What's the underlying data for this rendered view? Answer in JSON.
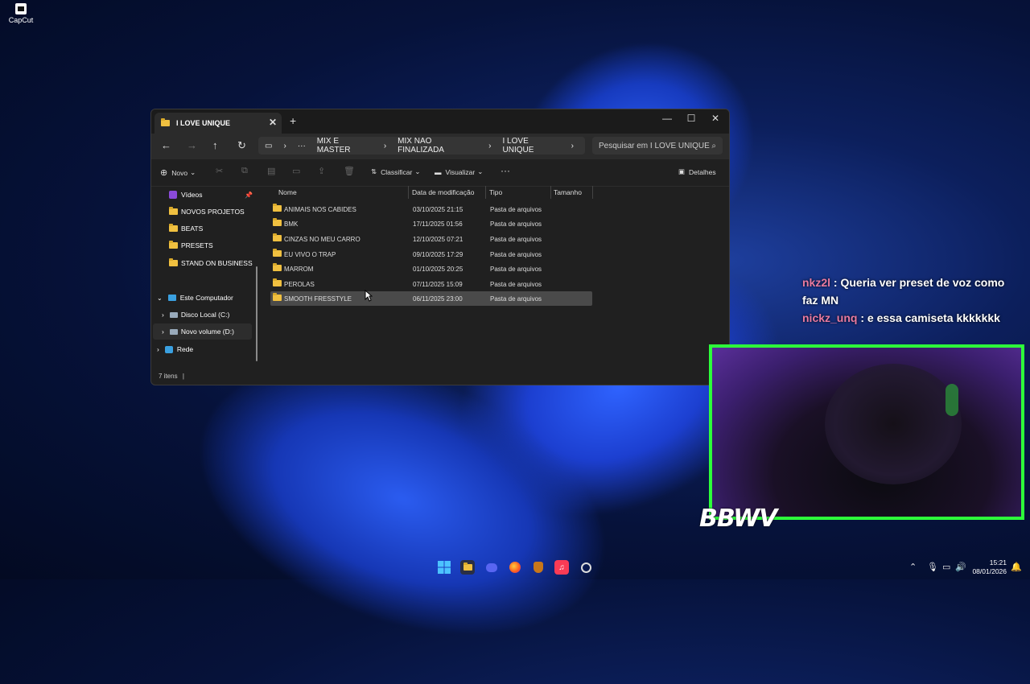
{
  "desktop": {
    "icons": [
      {
        "label": "CapCut",
        "icon": "capcut-icon"
      }
    ]
  },
  "explorer": {
    "tab_title": "I LOVE UNIQUE",
    "breadcrumb": [
      "MIX E MASTER",
      "MIX NAO FINALIZADA",
      "I LOVE UNIQUE"
    ],
    "search_placeholder": "Pesquisar em I LOVE UNIQUE",
    "toolbar": {
      "new": "Novo",
      "sort": "Classificar",
      "view": "Visualizar",
      "details": "Detalhes"
    },
    "sidebar": [
      {
        "label": "Vídeos",
        "icon": "videos-icon",
        "pinned": true
      },
      {
        "label": "NOVOS PROJETOS",
        "icon": "folder-icon"
      },
      {
        "label": "BEATS",
        "icon": "folder-icon"
      },
      {
        "label": "PRESETS",
        "icon": "folder-icon"
      },
      {
        "label": "STAND ON BUSINESS",
        "icon": "folder-icon"
      },
      {
        "label": "Este Computador",
        "icon": "computer-icon"
      },
      {
        "label": "Disco Local (C:)",
        "icon": "drive-icon"
      },
      {
        "label": "Novo volume (D:)",
        "icon": "drive-icon",
        "selected": true
      },
      {
        "label": "Rede",
        "icon": "network-icon"
      }
    ],
    "columns": [
      "Nome",
      "Data de modificação",
      "Tipo",
      "Tamanho"
    ],
    "rows": [
      {
        "name": "ANIMAIS NOS CABIDES",
        "date": "03/10/2025 21:15",
        "type": "Pasta de arquivos"
      },
      {
        "name": "BMK",
        "date": "17/11/2025 01:56",
        "type": "Pasta de arquivos"
      },
      {
        "name": "CINZAS NO MEU CARRO",
        "date": "12/10/2025 07:21",
        "type": "Pasta de arquivos"
      },
      {
        "name": "EU VIVO O TRAP",
        "date": "09/10/2025 17:29",
        "type": "Pasta de arquivos"
      },
      {
        "name": "MARROM",
        "date": "01/10/2025 20:25",
        "type": "Pasta de arquivos"
      },
      {
        "name": "PEROLAS",
        "date": "07/11/2025 15:09",
        "type": "Pasta de arquivos"
      },
      {
        "name": "SMOOTH FRESSTYLE",
        "date": "06/11/2025 23:00",
        "type": "Pasta de arquivos",
        "selected": true
      }
    ],
    "status": "7 itens"
  },
  "chat": [
    {
      "user": "nkz2l",
      "message": "Queria ver preset de voz como faz MN"
    },
    {
      "user": "nickz_unq",
      "message": "e essa camiseta kkkkkkk"
    }
  ],
  "overlay_logo": "BBWV",
  "taskbar": {
    "time": "15:21",
    "date": "08/01/2026"
  },
  "colors": {
    "cam_border": "#2dff3a",
    "chat_user": "#e97aa0",
    "folder": "#f0c040"
  }
}
